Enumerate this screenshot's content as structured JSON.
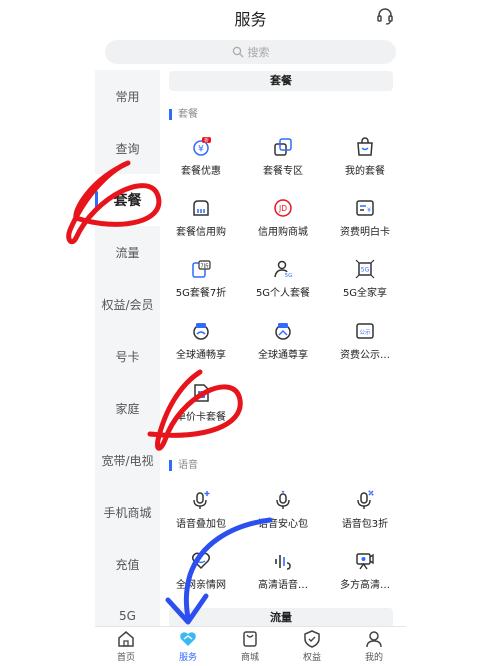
{
  "header": {
    "title": "服务"
  },
  "search": {
    "placeholder": "搜索"
  },
  "sidebar": {
    "items": [
      {
        "label": "常用"
      },
      {
        "label": "查询"
      },
      {
        "label": "套餐"
      },
      {
        "label": "流量"
      },
      {
        "label": "权益/会员"
      },
      {
        "label": "号卡"
      },
      {
        "label": "家庭"
      },
      {
        "label": "宽带/电视"
      },
      {
        "label": "手机商城"
      },
      {
        "label": "充值"
      },
      {
        "label": "5G"
      }
    ],
    "active": "套餐"
  },
  "content": {
    "top_pill": "套餐",
    "section_package": {
      "title": "套餐",
      "items": [
        {
          "label": "套餐优惠",
          "icon": "package-discount-icon"
        },
        {
          "label": "套餐专区",
          "icon": "package-zone-icon"
        },
        {
          "label": "我的套餐",
          "icon": "my-package-icon"
        },
        {
          "label": "套餐信用购",
          "icon": "credit-buy-icon"
        },
        {
          "label": "信用购商城",
          "icon": "jd-mall-icon"
        },
        {
          "label": "资费明白卡",
          "icon": "tariff-card-icon"
        },
        {
          "label": "5G套餐7折",
          "icon": "5g-discount-icon"
        },
        {
          "label": "5G个人套餐",
          "icon": "5g-person-icon"
        },
        {
          "label": "5G全家享",
          "icon": "5g-family-icon"
        },
        {
          "label": "全球通畅享",
          "icon": "global-enjoy-icon"
        },
        {
          "label": "全球通尊享",
          "icon": "global-premium-icon"
        },
        {
          "label": "资费公示…",
          "icon": "tariff-notice-icon"
        },
        {
          "label": "单价卡套餐",
          "icon": "single-card-icon"
        }
      ]
    },
    "section_voice": {
      "title": "语音",
      "items": [
        {
          "label": "语音叠加包",
          "icon": "mic-plus-icon"
        },
        {
          "label": "语音安心包",
          "icon": "mic-heart-icon"
        },
        {
          "label": "语音包3折",
          "icon": "mic-discount-icon"
        },
        {
          "label": "全网亲情网",
          "icon": "family-net-icon"
        },
        {
          "label": "高清语音…",
          "icon": "hd-voice-icon"
        },
        {
          "label": "多方高清…",
          "icon": "multi-call-icon"
        }
      ]
    },
    "bottom_pill": "流量",
    "icon_badges": {
      "discount": "折",
      "card": "单",
      "jd": "JD",
      "tariff": "¥",
      "five_g": "5G",
      "seven": "7折",
      "notice": "公示"
    }
  },
  "tabbar": {
    "items": [
      {
        "label": "首页"
      },
      {
        "label": "服务"
      },
      {
        "label": "商城"
      },
      {
        "label": "权益"
      },
      {
        "label": "我的"
      }
    ],
    "active": "服务"
  },
  "colors": {
    "accent": "#2f6bff",
    "annotation_red": "#e8141c",
    "annotation_blue": "#2c4ff0"
  }
}
